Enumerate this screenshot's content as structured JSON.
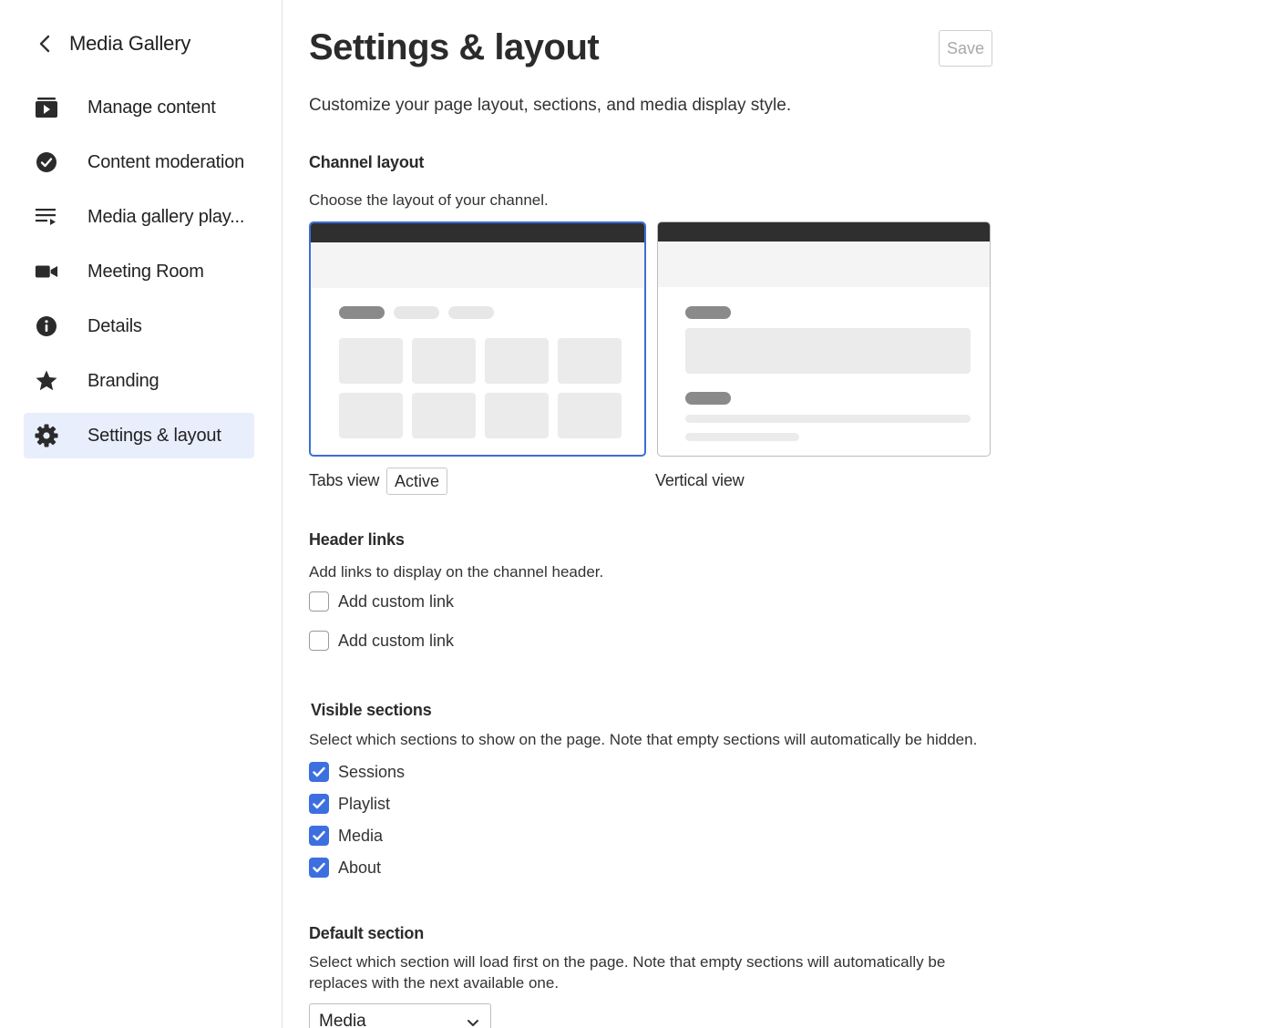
{
  "sidebar": {
    "back_title": "Media Gallery",
    "items": [
      {
        "label": "Manage content",
        "icon": "play-folder-icon",
        "active": false
      },
      {
        "label": "Content moderation",
        "icon": "check-circle-icon",
        "active": false
      },
      {
        "label": "Media gallery play...",
        "icon": "playlist-icon",
        "active": false
      },
      {
        "label": "Meeting Room",
        "icon": "video-camera-icon",
        "active": false
      },
      {
        "label": "Details",
        "icon": "info-icon",
        "active": false
      },
      {
        "label": "Branding",
        "icon": "star-icon",
        "active": false
      },
      {
        "label": "Settings & layout",
        "icon": "gear-icon",
        "active": true
      }
    ]
  },
  "header": {
    "title": "Settings & layout",
    "save_label": "Save",
    "subtitle": "Customize your page layout, sections, and media display style."
  },
  "channel_layout": {
    "heading": "Channel layout",
    "description": "Choose the layout of your channel.",
    "options": [
      {
        "label": "Tabs view",
        "badge": "Active",
        "selected": true
      },
      {
        "label": "Vertical view",
        "selected": false
      }
    ]
  },
  "header_links": {
    "heading": "Header links",
    "description": "Add links to display on the channel header.",
    "links": [
      {
        "label": "Add custom link",
        "checked": false
      },
      {
        "label": "Add custom link",
        "checked": false
      }
    ]
  },
  "visible_sections": {
    "heading": "Visible sections",
    "description": "Select which sections to show on the page. Note that empty sections will automatically be hidden.",
    "items": [
      {
        "label": "Sessions",
        "checked": true
      },
      {
        "label": "Playlist",
        "checked": true
      },
      {
        "label": "Media",
        "checked": true
      },
      {
        "label": "About",
        "checked": true
      }
    ]
  },
  "default_section": {
    "heading": "Default section",
    "description_line1": "Select which section will load first on the page. Note that empty sections will automatically be",
    "description_line2": "replaces with the next available one.",
    "selected": "Media"
  },
  "colors": {
    "accent": "#3d6fe0",
    "active_nav_bg": "#e8eefc",
    "selected_card_border": "#3b6fd6"
  }
}
